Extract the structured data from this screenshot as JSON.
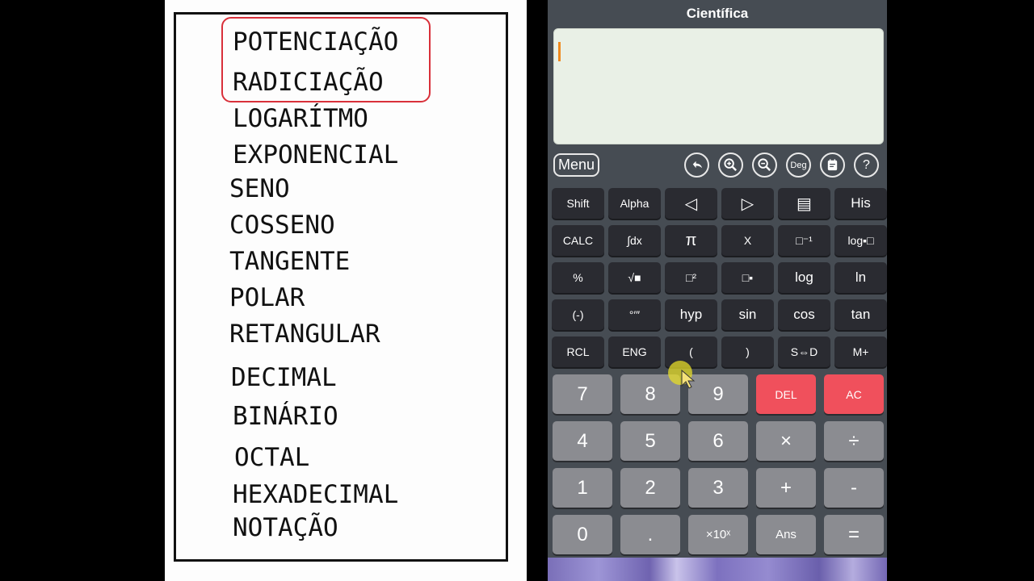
{
  "slide": {
    "topics": [
      "POTENCIAÇÃO",
      "RADICIAÇÃO",
      "LOGARÍTMO",
      "EXPONENCIAL",
      "SENO",
      "COSSENO",
      "TANGENTE",
      "POLAR",
      "RETANGULAR",
      "DECIMAL",
      "BINÁRIO",
      "OCTAL",
      "HEXADECIMAL",
      "NOTAÇÃO"
    ],
    "highlighted": [
      "POTENCIAÇÃO",
      "RADICIAÇÃO"
    ],
    "highlight_color": "#d9303a"
  },
  "calculator": {
    "title": "Científica",
    "display_value": "",
    "cursor_color": "#f08a1e",
    "toolbar": {
      "menu_label": "Menu",
      "icons": [
        {
          "name": "undo-icon"
        },
        {
          "name": "zoom-in-icon"
        },
        {
          "name": "zoom-out-icon"
        },
        {
          "name": "angle-mode-icon",
          "label": "Deg"
        },
        {
          "name": "notes-icon"
        },
        {
          "name": "help-icon",
          "label": "?"
        }
      ]
    },
    "function_rows": [
      [
        "Shift",
        "Alpha",
        "◁",
        "▷",
        "▤",
        "His"
      ],
      [
        "CALC",
        "∫dx",
        "π",
        "X",
        "□⁻¹",
        "log▪□"
      ],
      [
        "%",
        "√■",
        "□²",
        "□▪",
        "log",
        "ln"
      ],
      [
        "(-)",
        "°′″",
        "hyp",
        "sin",
        "cos",
        "tan"
      ],
      [
        "RCL",
        "ENG",
        "(",
        ")",
        "S⇔D",
        "M+"
      ]
    ],
    "number_rows": [
      [
        "7",
        "8",
        "9",
        "DEL",
        "AC"
      ],
      [
        "4",
        "5",
        "6",
        "×",
        "÷"
      ],
      [
        "1",
        "2",
        "3",
        "+",
        "-"
      ],
      [
        "0",
        ".",
        "×10ˣ",
        "Ans",
        "="
      ]
    ],
    "colors": {
      "body": "#464c53",
      "function_key": "#2a2b31",
      "number_key": "#8b8c91",
      "danger_key": "#f0505c",
      "display": "#e9f0e6"
    }
  }
}
